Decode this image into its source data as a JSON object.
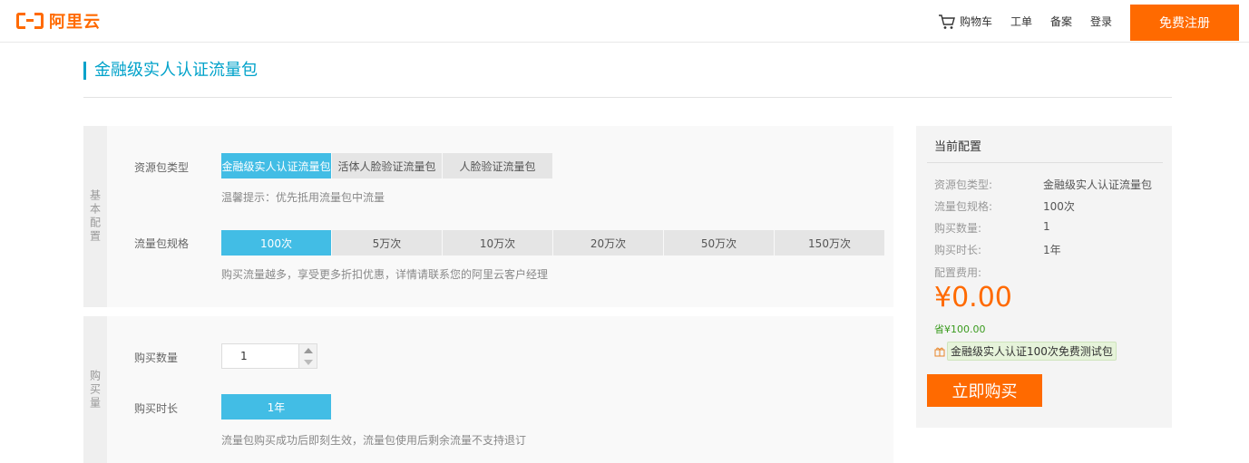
{
  "header": {
    "logo_text": "阿里云",
    "nav": {
      "cart": "购物车",
      "ticket": "工单",
      "icp": "备案",
      "login": "登录"
    },
    "signup": "免费注册"
  },
  "page_title": "金融级实人认证流量包",
  "basic": {
    "side_label": "基本配置",
    "package_type": {
      "label": "资源包类型",
      "options": [
        "金融级实人认证流量包",
        "活体人脸验证流量包",
        "人脸验证流量包"
      ],
      "selected_index": 0,
      "hint": "温馨提示：优先抵用流量包中流量"
    },
    "package_spec": {
      "label": "流量包规格",
      "options": [
        "100次",
        "5万次",
        "10万次",
        "20万次",
        "50万次",
        "150万次"
      ],
      "selected_index": 0,
      "hint": "购买流量越多，享受更多折扣优惠，详情请联系您的阿里云客户经理"
    }
  },
  "purchase": {
    "side_label": "购买量",
    "quantity": {
      "label": "购买数量",
      "value": "1"
    },
    "duration": {
      "label": "购买时长",
      "options": [
        "1年"
      ],
      "selected_index": 0,
      "hint": "流量包购买成功后即刻生效，流量包使用后剩余流量不支持退订"
    }
  },
  "summary": {
    "title": "当前配置",
    "items": [
      {
        "key": "资源包类型:",
        "value": "金融级实人认证流量包"
      },
      {
        "key": "流量包规格:",
        "value": "100次"
      },
      {
        "key": "购买数量:",
        "value": "1"
      },
      {
        "key": "购买时长:",
        "value": "1年"
      }
    ],
    "fee_label": "配置费用:",
    "price": "¥0.00",
    "save": "省¥100.00",
    "gift": "金融级实人认证100次免费测试包",
    "buy_button": "立即购买"
  },
  "colors": {
    "brand_orange": "#ff6a00",
    "accent_blue": "#00a2ca",
    "selected_option": "#42bde5",
    "save_green": "#3a9b1e"
  }
}
